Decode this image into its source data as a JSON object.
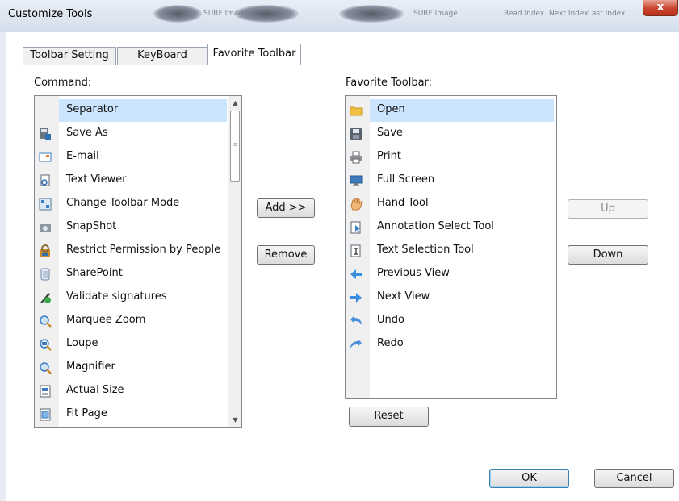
{
  "window": {
    "title": "Customize Tools",
    "close_label": "x",
    "header_texts": [
      "SURF Image",
      "SURF Image",
      "Read Index",
      "Next Index",
      "Last Index"
    ]
  },
  "tabs": [
    {
      "label": "Toolbar Setting",
      "active": false
    },
    {
      "label": "KeyBoard",
      "active": false
    },
    {
      "label": "Favorite Toolbar",
      "active": true
    }
  ],
  "command": {
    "label": "Command:",
    "items": [
      {
        "label": "Separator",
        "icon": "",
        "selected": true
      },
      {
        "label": "Save As",
        "icon": "save-as-icon"
      },
      {
        "label": "E-mail",
        "icon": "email-icon"
      },
      {
        "label": "Text Viewer",
        "icon": "text-viewer-icon"
      },
      {
        "label": "Change Toolbar Mode",
        "icon": "toolbar-mode-icon"
      },
      {
        "label": "SnapShot",
        "icon": "camera-icon"
      },
      {
        "label": "Restrict Permission by People",
        "icon": "permission-icon"
      },
      {
        "label": "SharePoint",
        "icon": "sharepoint-icon"
      },
      {
        "label": "Validate signatures",
        "icon": "signature-icon"
      },
      {
        "label": "Marquee Zoom",
        "icon": "marquee-zoom-icon"
      },
      {
        "label": "Loupe",
        "icon": "loupe-icon"
      },
      {
        "label": "Magnifier",
        "icon": "magnifier-icon"
      },
      {
        "label": "Actual Size",
        "icon": "actual-size-icon"
      },
      {
        "label": "Fit Page",
        "icon": "fit-page-icon"
      }
    ]
  },
  "favorite": {
    "label": "Favorite Toolbar:",
    "items": [
      {
        "label": "Open",
        "icon": "folder-icon",
        "selected": true
      },
      {
        "label": "Save",
        "icon": "floppy-icon"
      },
      {
        "label": "Print",
        "icon": "printer-icon"
      },
      {
        "label": "Full Screen",
        "icon": "monitor-icon"
      },
      {
        "label": "Hand Tool",
        "icon": "hand-icon"
      },
      {
        "label": "Annotation Select Tool",
        "icon": "annotation-select-icon"
      },
      {
        "label": "Text Selection Tool",
        "icon": "text-select-icon"
      },
      {
        "label": "Previous View",
        "icon": "arrow-left-icon"
      },
      {
        "label": "Next View",
        "icon": "arrow-right-icon"
      },
      {
        "label": "Undo",
        "icon": "undo-icon"
      },
      {
        "label": "Redo",
        "icon": "redo-icon"
      }
    ]
  },
  "buttons": {
    "add": "Add >>",
    "remove": "Remove",
    "up": "Up",
    "down": "Down",
    "reset": "Reset",
    "ok": "OK",
    "cancel": "Cancel"
  },
  "colors": {
    "selection": "#cce5ff",
    "gutter": "#f0f0f0",
    "border": "#9aa4b2"
  }
}
